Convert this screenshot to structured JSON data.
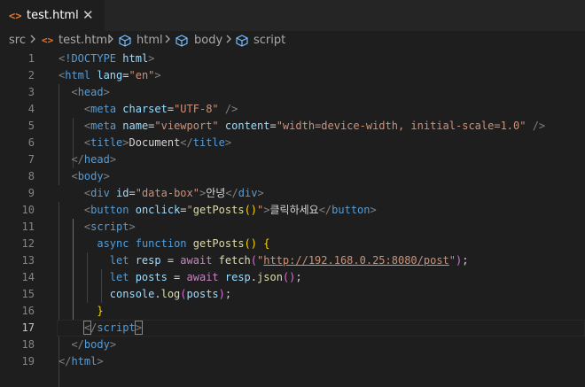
{
  "tab": {
    "icon": "<>",
    "filename": "test.html",
    "close": "✕"
  },
  "breadcrumb": [
    "src",
    "test.html",
    "html",
    "body",
    "script"
  ],
  "lines": [
    {
      "n": "1",
      "parts": [
        [
          "p",
          "<"
        ],
        [
          "k",
          "!DOCTYPE "
        ],
        [
          "a",
          "html"
        ],
        [
          "p",
          ">"
        ]
      ]
    },
    {
      "n": "2",
      "parts": [
        [
          "p",
          "<"
        ],
        [
          "t",
          "html "
        ],
        [
          "a",
          "lang"
        ],
        [
          "w",
          "="
        ],
        [
          "s",
          "\"en\""
        ],
        [
          "p",
          ">"
        ]
      ]
    },
    {
      "n": "3",
      "parts": [
        [
          "w",
          "  "
        ],
        [
          "p",
          "<"
        ],
        [
          "t",
          "head"
        ],
        [
          "p",
          ">"
        ]
      ]
    },
    {
      "n": "4",
      "parts": [
        [
          "w",
          "    "
        ],
        [
          "p",
          "<"
        ],
        [
          "t",
          "meta "
        ],
        [
          "a",
          "charset"
        ],
        [
          "w",
          "="
        ],
        [
          "s",
          "\"UTF-8\""
        ],
        [
          "w",
          " "
        ],
        [
          "p",
          "/>"
        ]
      ]
    },
    {
      "n": "5",
      "parts": [
        [
          "w",
          "    "
        ],
        [
          "p",
          "<"
        ],
        [
          "t",
          "meta "
        ],
        [
          "a",
          "name"
        ],
        [
          "w",
          "="
        ],
        [
          "s",
          "\"viewport\""
        ],
        [
          "w",
          " "
        ],
        [
          "a",
          "content"
        ],
        [
          "w",
          "="
        ],
        [
          "s",
          "\"width=device-width, initial-scale=1.0\""
        ],
        [
          "w",
          " "
        ],
        [
          "p",
          "/>"
        ]
      ]
    },
    {
      "n": "6",
      "parts": [
        [
          "w",
          "    "
        ],
        [
          "p",
          "<"
        ],
        [
          "t",
          "title"
        ],
        [
          "p",
          ">"
        ],
        [
          "w",
          "Document"
        ],
        [
          "p",
          "</"
        ],
        [
          "t",
          "title"
        ],
        [
          "p",
          ">"
        ]
      ]
    },
    {
      "n": "7",
      "parts": [
        [
          "w",
          "  "
        ],
        [
          "p",
          "</"
        ],
        [
          "t",
          "head"
        ],
        [
          "p",
          ">"
        ]
      ]
    },
    {
      "n": "8",
      "parts": [
        [
          "w",
          "  "
        ],
        [
          "p",
          "<"
        ],
        [
          "t",
          "body"
        ],
        [
          "p",
          ">"
        ]
      ]
    },
    {
      "n": "9",
      "parts": [
        [
          "w",
          "    "
        ],
        [
          "p",
          "<"
        ],
        [
          "t",
          "div "
        ],
        [
          "a",
          "id"
        ],
        [
          "w",
          "="
        ],
        [
          "s",
          "\"data-box\""
        ],
        [
          "p",
          ">"
        ],
        [
          "w",
          "안녕"
        ],
        [
          "p",
          "</"
        ],
        [
          "t",
          "div"
        ],
        [
          "p",
          ">"
        ]
      ]
    },
    {
      "n": "10",
      "parts": [
        [
          "w",
          "    "
        ],
        [
          "p",
          "<"
        ],
        [
          "t",
          "button "
        ],
        [
          "a",
          "onclick"
        ],
        [
          "w",
          "="
        ],
        [
          "s",
          "\""
        ],
        [
          "f",
          "getPosts"
        ],
        [
          "y",
          "()"
        ],
        [
          "s",
          "\""
        ],
        [
          "p",
          ">"
        ],
        [
          "w",
          "클릭하세요"
        ],
        [
          "p",
          "</"
        ],
        [
          "t",
          "button"
        ],
        [
          "p",
          ">"
        ]
      ]
    },
    {
      "n": "11",
      "parts": [
        [
          "w",
          "    "
        ],
        [
          "p",
          "<"
        ],
        [
          "t",
          "script"
        ],
        [
          "p",
          ">"
        ]
      ]
    },
    {
      "n": "12",
      "parts": [
        [
          "w",
          "      "
        ],
        [
          "k",
          "async "
        ],
        [
          "k",
          "function "
        ],
        [
          "f",
          "getPosts"
        ],
        [
          "y",
          "() {"
        ]
      ]
    },
    {
      "n": "13",
      "parts": [
        [
          "w",
          "        "
        ],
        [
          "k",
          "let "
        ],
        [
          "a",
          "resp"
        ],
        [
          "w",
          " = "
        ],
        [
          "c",
          "await "
        ],
        [
          "f",
          "fetch"
        ],
        [
          "v",
          "("
        ],
        [
          "s",
          "\""
        ],
        [
          "su",
          "http://192.168.0.25:8080/post"
        ],
        [
          "s",
          "\""
        ],
        [
          "v",
          ")"
        ],
        [
          "w",
          ";"
        ]
      ]
    },
    {
      "n": "14",
      "parts": [
        [
          "w",
          "        "
        ],
        [
          "k",
          "let "
        ],
        [
          "a",
          "posts"
        ],
        [
          "w",
          " = "
        ],
        [
          "c",
          "await "
        ],
        [
          "a",
          "resp"
        ],
        [
          "w",
          "."
        ],
        [
          "f",
          "json"
        ],
        [
          "v",
          "()"
        ],
        [
          "w",
          ";"
        ]
      ]
    },
    {
      "n": "15",
      "parts": [
        [
          "w",
          "        "
        ],
        [
          "a",
          "console"
        ],
        [
          "w",
          "."
        ],
        [
          "f",
          "log"
        ],
        [
          "v",
          "("
        ],
        [
          "a",
          "posts"
        ],
        [
          "v",
          ")"
        ],
        [
          "w",
          ";"
        ]
      ]
    },
    {
      "n": "16",
      "parts": [
        [
          "w",
          "      "
        ],
        [
          "y",
          "}"
        ]
      ]
    },
    {
      "n": "17",
      "parts": [
        [
          "w",
          "    "
        ],
        [
          "pb",
          "<"
        ],
        [
          "p",
          "/"
        ],
        [
          "t",
          "script"
        ],
        [
          "pb",
          ">"
        ]
      ]
    },
    {
      "n": "18",
      "parts": [
        [
          "w",
          "  "
        ],
        [
          "p",
          "</"
        ],
        [
          "t",
          "body"
        ],
        [
          "p",
          ">"
        ]
      ]
    },
    {
      "n": "19",
      "parts": [
        [
          "p",
          "</"
        ],
        [
          "t",
          "html"
        ],
        [
          "p",
          ">"
        ]
      ]
    }
  ],
  "active_line": "17"
}
